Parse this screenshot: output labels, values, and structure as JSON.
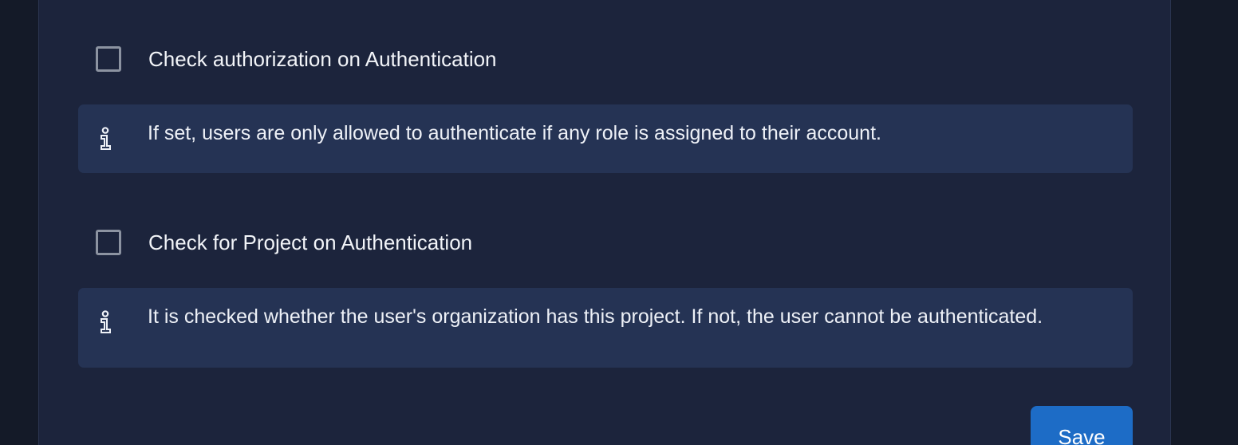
{
  "settings": [
    {
      "label": "Check authorization on Authentication",
      "checked": false,
      "info": "If set, users are only allowed to authenticate if any role is assigned to their account.",
      "info_icon": "info-icon"
    },
    {
      "label": "Check for Project on Authentication",
      "checked": false,
      "info": "It is checked whether the user's organization has this project. If not, the user cannot be authenticated.",
      "info_icon": "info-icon"
    }
  ],
  "actions": {
    "save_label": "Save"
  },
  "colors": {
    "page_background": "#141a28",
    "panel_background": "#1c243c",
    "info_background": "#253354",
    "checkbox_border": "#8c93a1",
    "primary_button": "#1d6cc6"
  }
}
